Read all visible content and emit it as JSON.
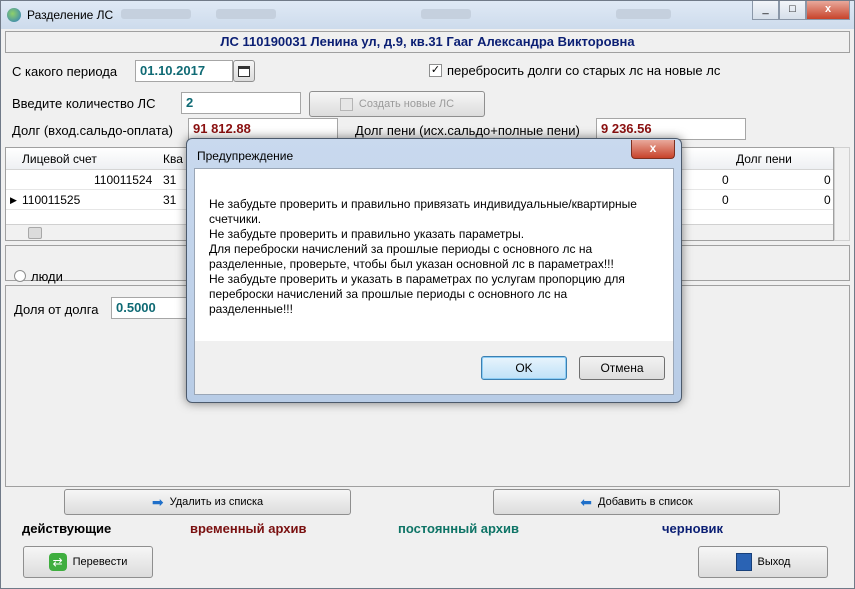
{
  "window": {
    "title": "Разделение ЛС",
    "buttons": [
      "_",
      "□",
      "x"
    ]
  },
  "header": {
    "text": "ЛС 110190031   Ленина ул, д.9, кв.31   Гааг Александра Викторовна"
  },
  "period": {
    "label": "С какого периода",
    "value": "01.10.2017"
  },
  "transfer_debts": {
    "checked": true,
    "label": "перебросить долги со старых лс на новые лс"
  },
  "count": {
    "label": "Введите количество ЛС",
    "value": "2"
  },
  "create_button": {
    "label": "Создать новые ЛС"
  },
  "debt": {
    "label": "Долг (вход.сальдо-оплата)",
    "value": "91 812.88"
  },
  "penalty": {
    "label": "Долг пени (исх.сальдо+полные пени)",
    "value": "9 236.56"
  },
  "grid": {
    "columns": [
      "Лицевой счет",
      "Ква",
      "Долг пени"
    ],
    "rows": [
      {
        "account": "110011524",
        "apt": "31",
        "c1": "0",
        "c2": "0"
      },
      {
        "account": "110011525",
        "apt": "31",
        "c1": "0",
        "c2": "0"
      }
    ]
  },
  "people": {
    "label": "люди"
  },
  "share": {
    "label": "Доля от долга",
    "value": "0.5000"
  },
  "remove_button": {
    "label": "Удалить из списка"
  },
  "add_button": {
    "label": "Добавить в список"
  },
  "statuses": {
    "active": "действующие",
    "temp_archive": "временный архив",
    "perm_archive": "постоянный архив",
    "draft": "черновик"
  },
  "transfer_button": {
    "label": "Перевести"
  },
  "exit_button": {
    "label": "Выход"
  },
  "dialog": {
    "title": "Предупреждение",
    "lines": [
      "Не забудьте проверить и правильно привязать индивидуальные/квартирные",
      "счетчики.",
      "Не забудьте проверить и правильно указать параметры.",
      "Для переброски начислений за прошлые периоды с основного лс на",
      "разделенные, проверьте, чтобы был указан основной лс в параметрах!!!",
      "Не забудьте проверить и указать в параметрах по услугам пропорцию для",
      "переброски начислений за прошлые периоды с основного лс на",
      "разделенные!!!"
    ],
    "ok": "OK",
    "cancel": "Отмена"
  },
  "colors": {
    "header_blue": "#0b1f74",
    "value_green": "#0f6a74",
    "value_red": "#8b1010",
    "status_temp": "#7a1010",
    "status_perm": "#0e7466",
    "status_draft": "#0b1f74"
  }
}
